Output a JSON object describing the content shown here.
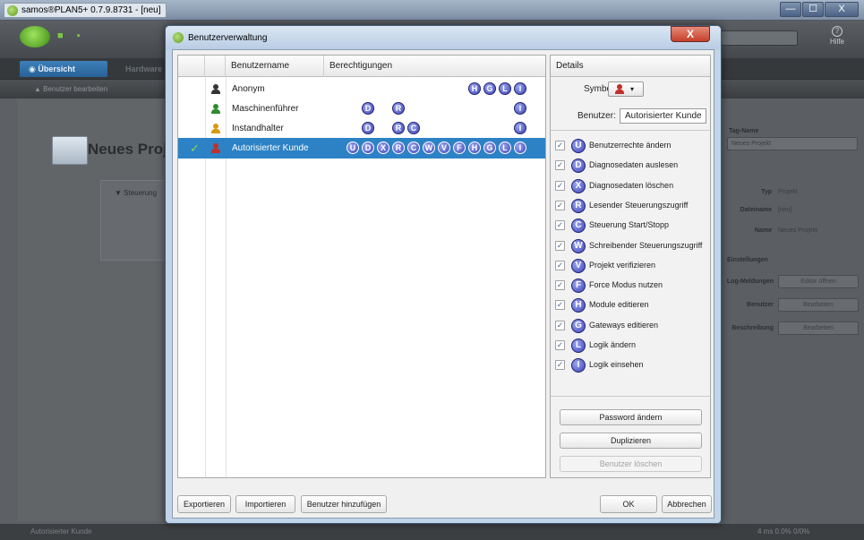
{
  "app": {
    "window_title": "samos®PLAN5+ 0.7.9.8731 - [neu]",
    "window_controls": [
      "—",
      "☐",
      "X"
    ],
    "help_label": "Hilfe",
    "tabs": [
      {
        "label": "Übersicht",
        "icon": "eye-icon"
      },
      {
        "label": "Hardware",
        "icon": "hardware-icon"
      }
    ],
    "subtoolbar_button": "Benutzer bearbeiten",
    "project_title": "Neues Projekt",
    "steuerung_label": "▼ Steuerung",
    "right_panel": {
      "tag_name_label": "Tag-Name",
      "tag_name_value": "Neues Projekt",
      "typ_label": "Typ",
      "typ_value": "Projekt",
      "dateiname_label": "Dateiname",
      "dateiname_value": "[neu]",
      "name_label": "Name",
      "name_value": "Neues Projekt",
      "einstellungen_label": "Einstellungen",
      "meldungen_label": "Log-Meldungen",
      "meldungen_button": "Editor öffnen",
      "benutzer_label": "Benutzer",
      "benutzer_button": "Bearbeiten",
      "beschreibung_label": "Beschreibung",
      "beschreibung_button": "Bearbeiten"
    },
    "status": {
      "user": "Autorisierter Kunde",
      "right": "4 ms  0.0%  0/0%"
    }
  },
  "dialog": {
    "title": "Benutzerverwaltung",
    "close_label": "X",
    "table": {
      "columns": [
        "Benutzername",
        "Berechtigungen"
      ],
      "rows": [
        {
          "name": "Anonym",
          "color": "#333333",
          "selected": false,
          "badges": [
            "H",
            "G",
            "L",
            "I"
          ]
        },
        {
          "name": "Maschinenführer",
          "color": "#2e8b2e",
          "selected": false,
          "badges": [
            "D",
            "R",
            "I"
          ]
        },
        {
          "name": "Instandhalter",
          "color": "#d89a12",
          "selected": false,
          "badges": [
            "D",
            "R",
            "C",
            "I"
          ]
        },
        {
          "name": "Autorisierter Kunde",
          "color": "#c0302a",
          "selected": true,
          "check": "✓",
          "badges": [
            "U",
            "D",
            "X",
            "R",
            "C",
            "W",
            "V",
            "F",
            "H",
            "G",
            "L",
            "I"
          ]
        }
      ]
    },
    "details": {
      "header": "Details",
      "symbol_label": "Symbol:",
      "symbol_color": "#c0302a",
      "symbol_arrow": "▾",
      "benutzer_label": "Benutzer:",
      "benutzer_value": "Autorisierter Kunde",
      "permissions": [
        {
          "letter": "U",
          "label": "Benutzerrechte ändern",
          "checked": true
        },
        {
          "letter": "D",
          "label": "Diagnosedaten auslesen",
          "checked": true
        },
        {
          "letter": "X",
          "label": "Diagnosedaten löschen",
          "checked": true
        },
        {
          "letter": "R",
          "label": "Lesender Steuerungszugriff",
          "checked": true
        },
        {
          "letter": "C",
          "label": "Steuerung Start/Stopp",
          "checked": true
        },
        {
          "letter": "W",
          "label": "Schreibender Steuerungszugriff",
          "checked": true
        },
        {
          "letter": "V",
          "label": "Projekt verifizieren",
          "checked": true
        },
        {
          "letter": "F",
          "label": "Force Modus nutzen",
          "checked": true
        },
        {
          "letter": "H",
          "label": "Module editieren",
          "checked": true
        },
        {
          "letter": "G",
          "label": "Gateways editieren",
          "checked": true
        },
        {
          "letter": "L",
          "label": "Logik ändern",
          "checked": true
        },
        {
          "letter": "I",
          "label": "Logik einsehen",
          "checked": true
        }
      ],
      "buttons": {
        "password": "Password ändern",
        "duplicate": "Duplizieren",
        "delete": "Benutzer löschen"
      }
    },
    "footer": {
      "export": "Exportieren",
      "import": "Importieren",
      "add_user": "Benutzer hinzufügen",
      "ok": "OK",
      "cancel": "Abbrechen"
    }
  }
}
